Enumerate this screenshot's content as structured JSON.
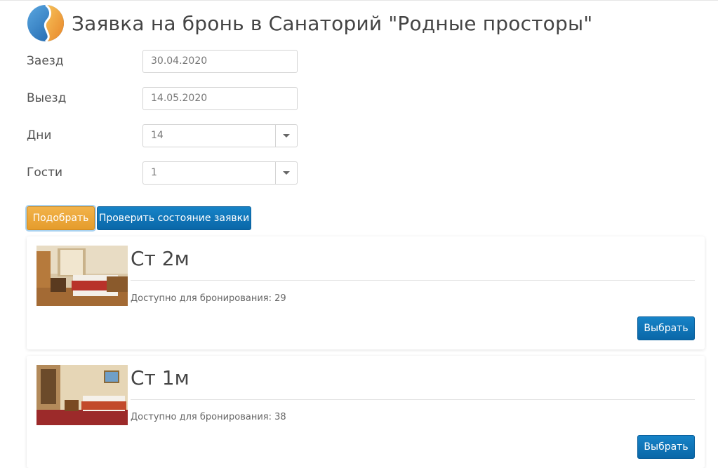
{
  "header": {
    "title": "Заявка на бронь в Санаторий \"Родные просторы\""
  },
  "form": {
    "checkin_label": "Заезд",
    "checkin_value": "30.04.2020",
    "checkout_label": "Выезд",
    "checkout_value": "14.05.2020",
    "days_label": "Дни",
    "days_value": "14",
    "guests_label": "Гости",
    "guests_value": "1"
  },
  "actions": {
    "search_label": "Подобрать",
    "check_status_label": "Проверить состояние заявки"
  },
  "rooms": [
    {
      "title": "Ст 2м",
      "availability": "Доступно для бронирования: 29",
      "select_label": "Выбрать"
    },
    {
      "title": "Ст 1м",
      "availability": "Доступно для бронирования: 38",
      "select_label": "Выбрать"
    }
  ],
  "colors": {
    "primary": "#0a67a8",
    "search_button": "#e8a236",
    "text": "#555555"
  }
}
